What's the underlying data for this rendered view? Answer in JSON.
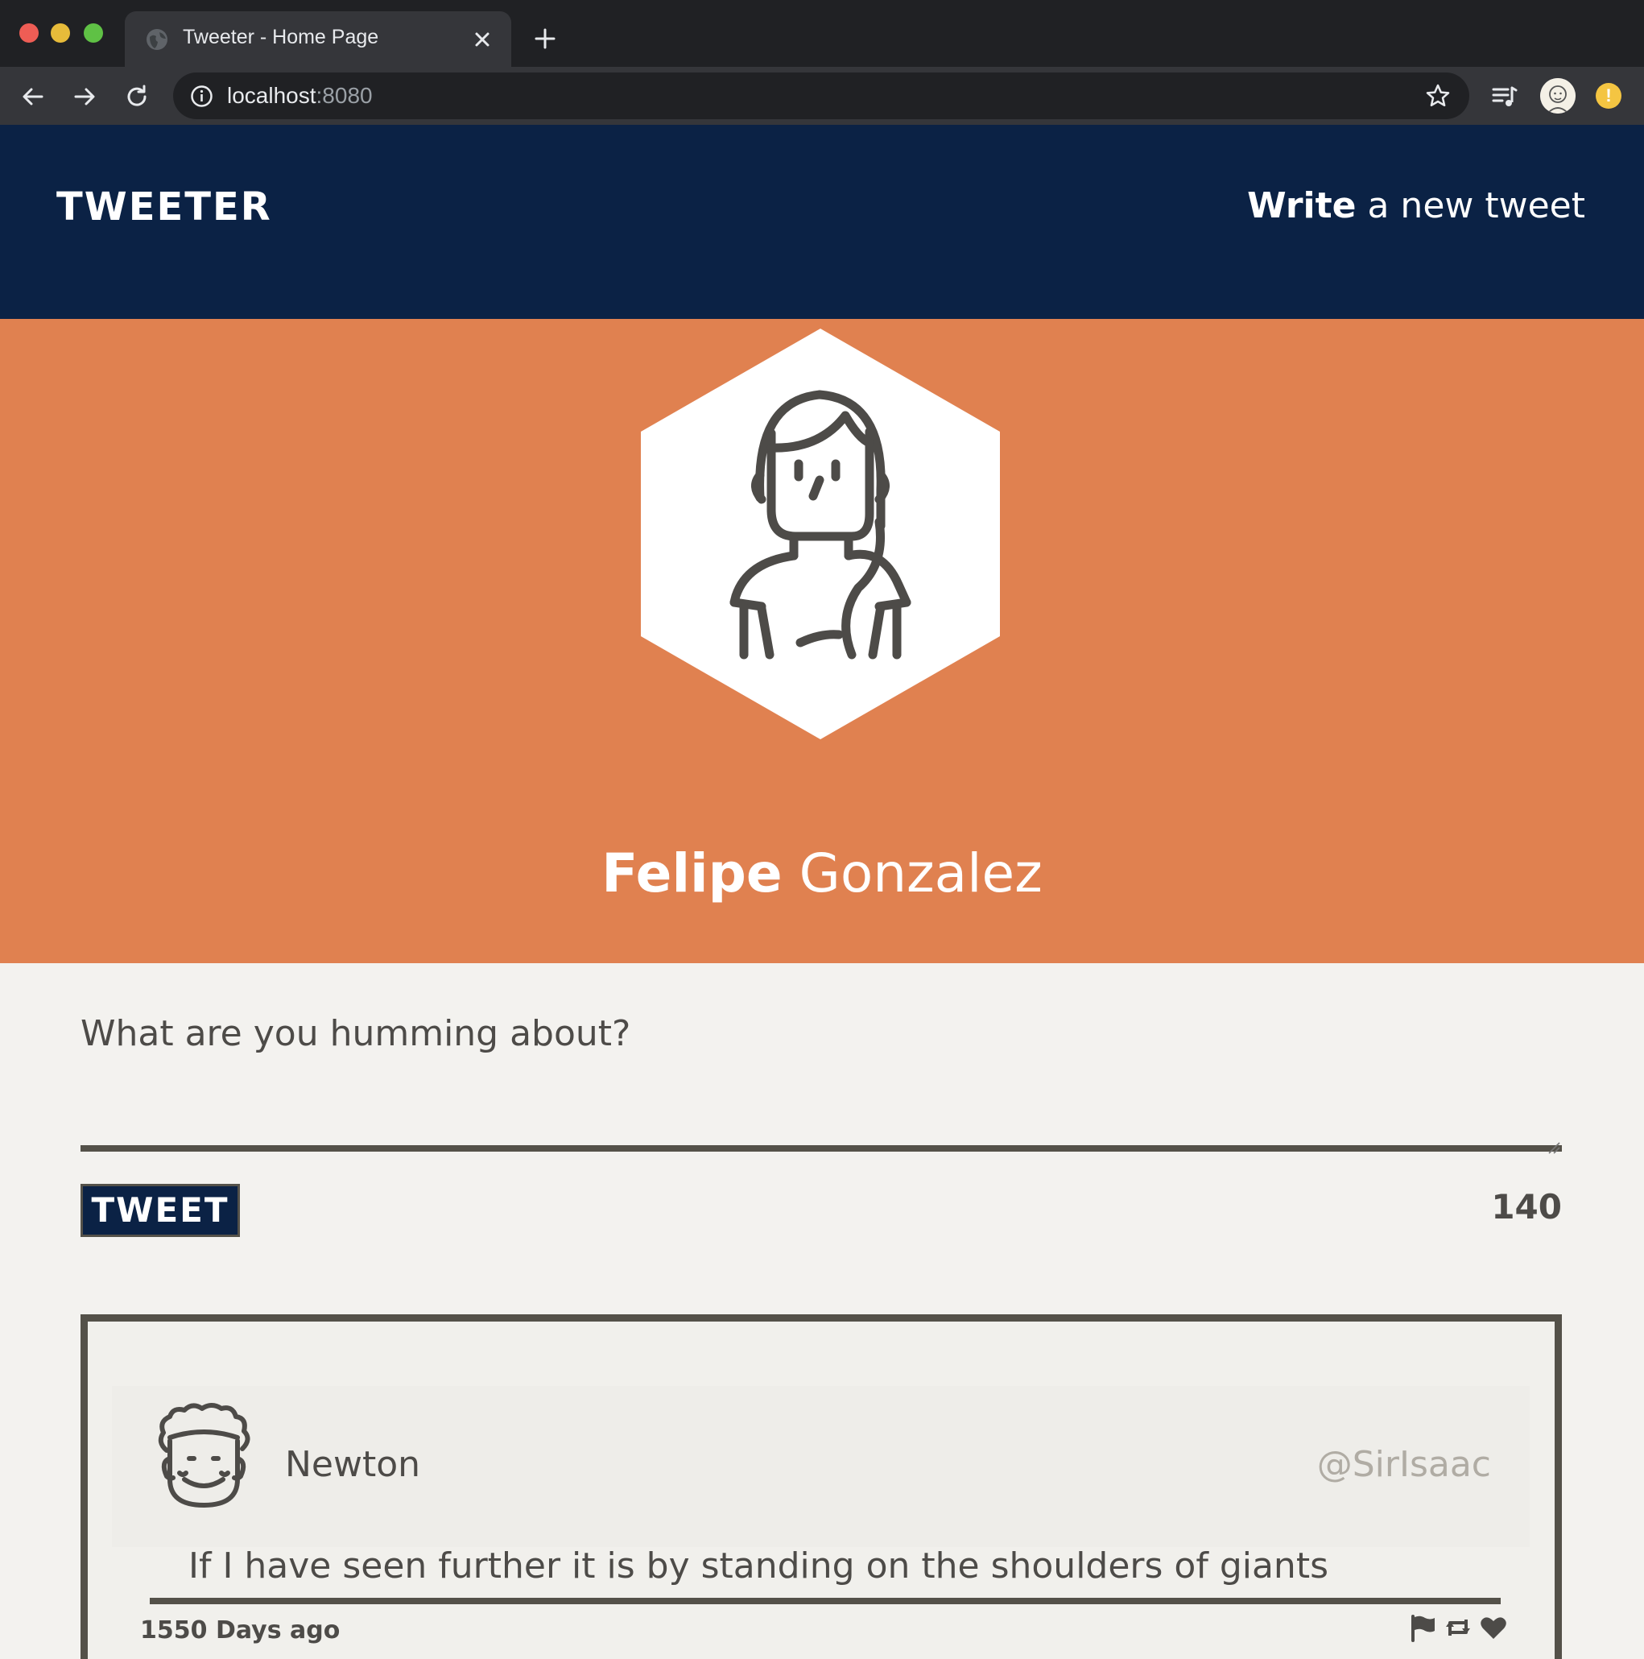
{
  "browser": {
    "tab_title": "Tweeter - Home Page",
    "url_host": "localhost",
    "url_port": ":8080",
    "icons": [
      "globe-icon",
      "close-icon",
      "plus-icon",
      "back-icon",
      "forward-icon",
      "reload-icon",
      "info-icon",
      "star-icon",
      "queue-icon",
      "profile-avatar",
      "alert-icon"
    ],
    "alert_glyph": "!"
  },
  "nav": {
    "logo": "TWEETER",
    "write_bold": "Write",
    "write_rest": " a new tweet"
  },
  "profile": {
    "first_name": "Felipe",
    "last_name": " Gonzalez",
    "banner_color": "#e08150"
  },
  "compose": {
    "prompt": "What are you humming about?",
    "input_value": "",
    "button_label": "TWEET",
    "counter": "140"
  },
  "tweet": {
    "name": "Newton",
    "handle": "@SirIsaac",
    "text": "If I have seen further it is by standing on the shoulders of giants",
    "time": "1550 Days ago",
    "actions": [
      "flag-icon",
      "retweet-icon",
      "heart-icon"
    ]
  },
  "colors": {
    "nav_bg": "#0b2245",
    "page_bg": "#f3f2ef",
    "text_dark": "#4d4b48",
    "border_dark": "#545149"
  }
}
